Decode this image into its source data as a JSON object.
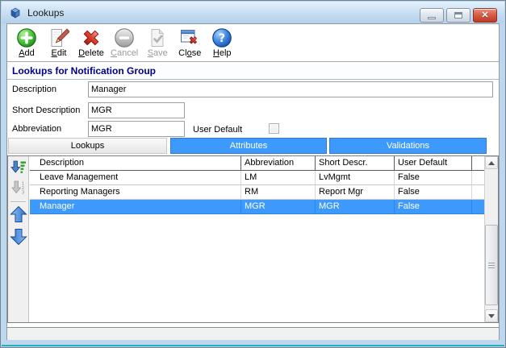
{
  "window": {
    "title": "Lookups",
    "controls": [
      {
        "name": "minimize",
        "icon": "minimize-icon"
      },
      {
        "name": "maximize",
        "icon": "maximize-icon"
      },
      {
        "name": "close",
        "icon": "close-icon"
      }
    ]
  },
  "toolbar": {
    "buttons": [
      {
        "label": "Add",
        "key": "A",
        "icon": "add",
        "enabled": true
      },
      {
        "label": "Edit",
        "key": "E",
        "icon": "edit",
        "enabled": true
      },
      {
        "label": "Delete",
        "key": "D",
        "icon": "delete",
        "enabled": true
      },
      {
        "label": "Cancel",
        "key": "C",
        "icon": "cancel",
        "enabled": false
      },
      {
        "label": "Save",
        "key": "S",
        "icon": "save",
        "enabled": false
      },
      {
        "label": "Close",
        "key": "o",
        "icon": "close-window",
        "enabled": true
      },
      {
        "label": "Help",
        "key": "H",
        "icon": "help",
        "enabled": true
      }
    ]
  },
  "section_header": {
    "title": "Lookups for Notification Group"
  },
  "form": {
    "description": {
      "label": "Description",
      "value": "Manager"
    },
    "short_description": {
      "label": "Short Description",
      "value": "MGR"
    },
    "abbreviation": {
      "label": "Abbreviation",
      "value": "MGR"
    },
    "user_default": {
      "label": "User Default",
      "checked": false
    }
  },
  "tabs": [
    {
      "label": "Lookups",
      "active": true
    },
    {
      "label": "Attributes",
      "active": false
    },
    {
      "label": "Validations",
      "active": false
    }
  ],
  "side_buttons": [
    {
      "icon": "sort",
      "enabled": true
    },
    {
      "icon": "sort-numeric",
      "enabled": false
    },
    {
      "icon": "move-up",
      "enabled": true
    },
    {
      "icon": "move-down",
      "enabled": true
    }
  ],
  "table": {
    "columns": [
      "Description",
      "Abbreviation",
      "Short Descr.",
      "User Default"
    ],
    "rows": [
      [
        "Leave Management",
        "LM",
        "LvMgmt",
        "False"
      ],
      [
        "Reporting Managers",
        "RM",
        "Report Mgr",
        "False"
      ],
      [
        "Manager",
        "MGR",
        "MGR",
        "False"
      ]
    ],
    "selected_row": 2
  },
  "colors": {
    "accent_blue": "#3d9afc",
    "header_navy": "#000080",
    "titlebar_blue": "#bdd8ee",
    "selection_blue": "#3d9afc"
  }
}
